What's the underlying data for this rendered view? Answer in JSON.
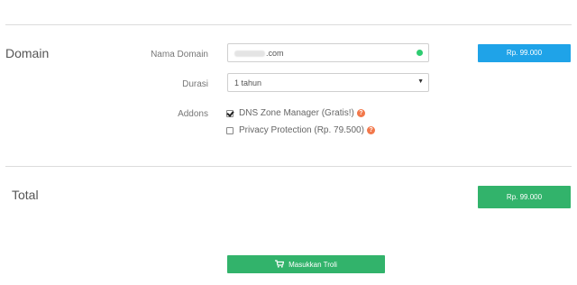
{
  "sections": {
    "domain_title": "Domain",
    "total_title": "Total"
  },
  "fields": {
    "nama_domain_label": "Nama Domain",
    "nama_domain_value_suffix": ".com",
    "durasi_label": "Durasi",
    "durasi_value": "1 tahun",
    "addons_label": "Addons"
  },
  "addons": {
    "dns": {
      "label": "DNS Zone Manager (Gratis!)",
      "checked": true
    },
    "privacy": {
      "label": "Privacy Protection (Rp. 79.500)",
      "checked": false
    }
  },
  "prices": {
    "domain_price": "Rp. 99.000",
    "total_price": "Rp. 99.000"
  },
  "actions": {
    "cart_button_label": "Masukkan Troli"
  },
  "icons": {
    "help": "question-circle-icon",
    "cart": "shopping-cart-icon",
    "status": "status-dot-icon",
    "select_caret": "caret-down-icon"
  },
  "colors": {
    "status_ok": "#2ecc71",
    "price_blue": "#1fa3e8",
    "action_green": "#32b36b",
    "help_orange": "#f2784b"
  }
}
